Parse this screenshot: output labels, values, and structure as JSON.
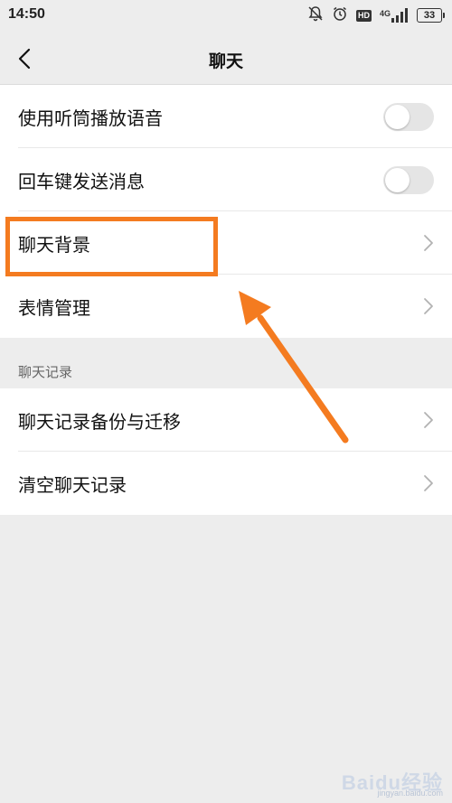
{
  "status_bar": {
    "time": "14:50",
    "network": "4G",
    "hd": "HD",
    "battery": "33"
  },
  "nav": {
    "title": "聊天"
  },
  "settings_group_1": {
    "items": [
      {
        "label": "使用听筒播放语音",
        "control": "toggle",
        "enabled": false
      },
      {
        "label": "回车键发送消息",
        "control": "toggle",
        "enabled": false
      },
      {
        "label": "聊天背景",
        "control": "chevron"
      },
      {
        "label": "表情管理",
        "control": "chevron"
      }
    ]
  },
  "section_header": "聊天记录",
  "settings_group_2": {
    "items": [
      {
        "label": "聊天记录备份与迁移",
        "control": "chevron"
      },
      {
        "label": "清空聊天记录",
        "control": "chevron"
      }
    ]
  },
  "annotation": {
    "highlighted_item": "聊天背景",
    "color": "#f47b20"
  },
  "watermark": {
    "text": "Baidu经验",
    "sub": "jingyan.baidu.com"
  },
  "colors": {
    "background": "#ededed",
    "toggle_off": "#e5e5e5",
    "annotation": "#f47b20"
  }
}
